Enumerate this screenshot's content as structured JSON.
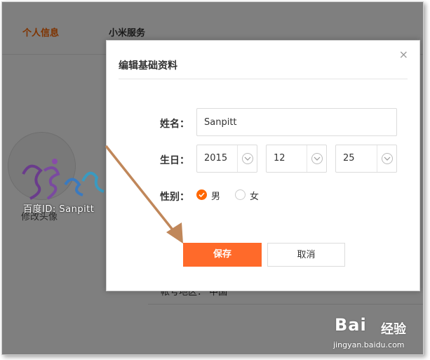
{
  "tabs": [
    {
      "label": "个人信息",
      "active": true
    },
    {
      "label": "小米服务",
      "active": false
    }
  ],
  "profile": {
    "avatar_label": "修改头像",
    "region_text": "帐号地区： 中国"
  },
  "watermark": {
    "text": "百度ID: Sanpitt"
  },
  "dialog": {
    "title": "编辑基础资料",
    "close": "×",
    "name_label": "姓名：",
    "name_value": "Sanpitt",
    "birthday_label": "生日：",
    "year": "2015",
    "month": "12",
    "day": "25",
    "gender_label": "性别：",
    "gender_male": "男",
    "gender_female": "女",
    "gender_selected": "男",
    "save_label": "保存",
    "cancel_label": "取消"
  },
  "brand": {
    "main": "Bai",
    "cn": "经验",
    "url": "jingyan.baidu.com"
  },
  "colors": {
    "accent": "#ff6700",
    "save_button": "#ff6a2a",
    "arrow": "#c0875a"
  }
}
